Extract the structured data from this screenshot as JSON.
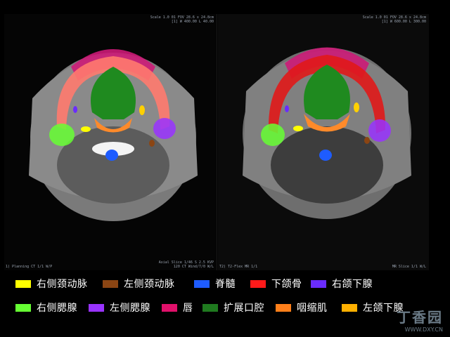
{
  "left_panel": {
    "header_top": "Scale 1.0 01 FOV 28.6 x 24.8cm",
    "header_sub": "[1] W 400.00 L 40.00",
    "footer_left": "1) Planning CT 1/1 W/P",
    "footer_right": "Axial  Slice 1/46  S 2.5 KVP 120  CT Wind/7/0 W/L"
  },
  "right_panel": {
    "header_top": "Scale 1.0 01 FOV 28.6 x 24.8cm",
    "header_sub": "[1] W 600.00 L 300.00",
    "footer_left": "T2) T2-Flex MR 1/1",
    "footer_right": "MR  Slice 1/1 W/L"
  },
  "legend": {
    "row1": [
      {
        "label": "右侧颈动脉",
        "color": "#ffff00"
      },
      {
        "label": "左侧颈动脉",
        "color": "#8b4513"
      },
      {
        "label": "脊髓",
        "color": "#1e5cff"
      },
      {
        "label": "下颌骨",
        "color": "#ff1a1a"
      },
      {
        "label": "右颌下腺",
        "color": "#6a2cff"
      }
    ],
    "row2": [
      {
        "label": "右侧腮腺",
        "color": "#66ff33"
      },
      {
        "label": "左侧腮腺",
        "color": "#9933ff"
      },
      {
        "label": "唇",
        "color": "#e0106a"
      },
      {
        "label": "扩展口腔",
        "color": "#1f7a1f"
      },
      {
        "label": "咽缩肌",
        "color": "#ff7f1a"
      },
      {
        "label": "左颌下腺",
        "color": "#ffb000"
      }
    ]
  },
  "watermark": {
    "logo": "丁香园",
    "url": "WWW.DXY.CN"
  }
}
